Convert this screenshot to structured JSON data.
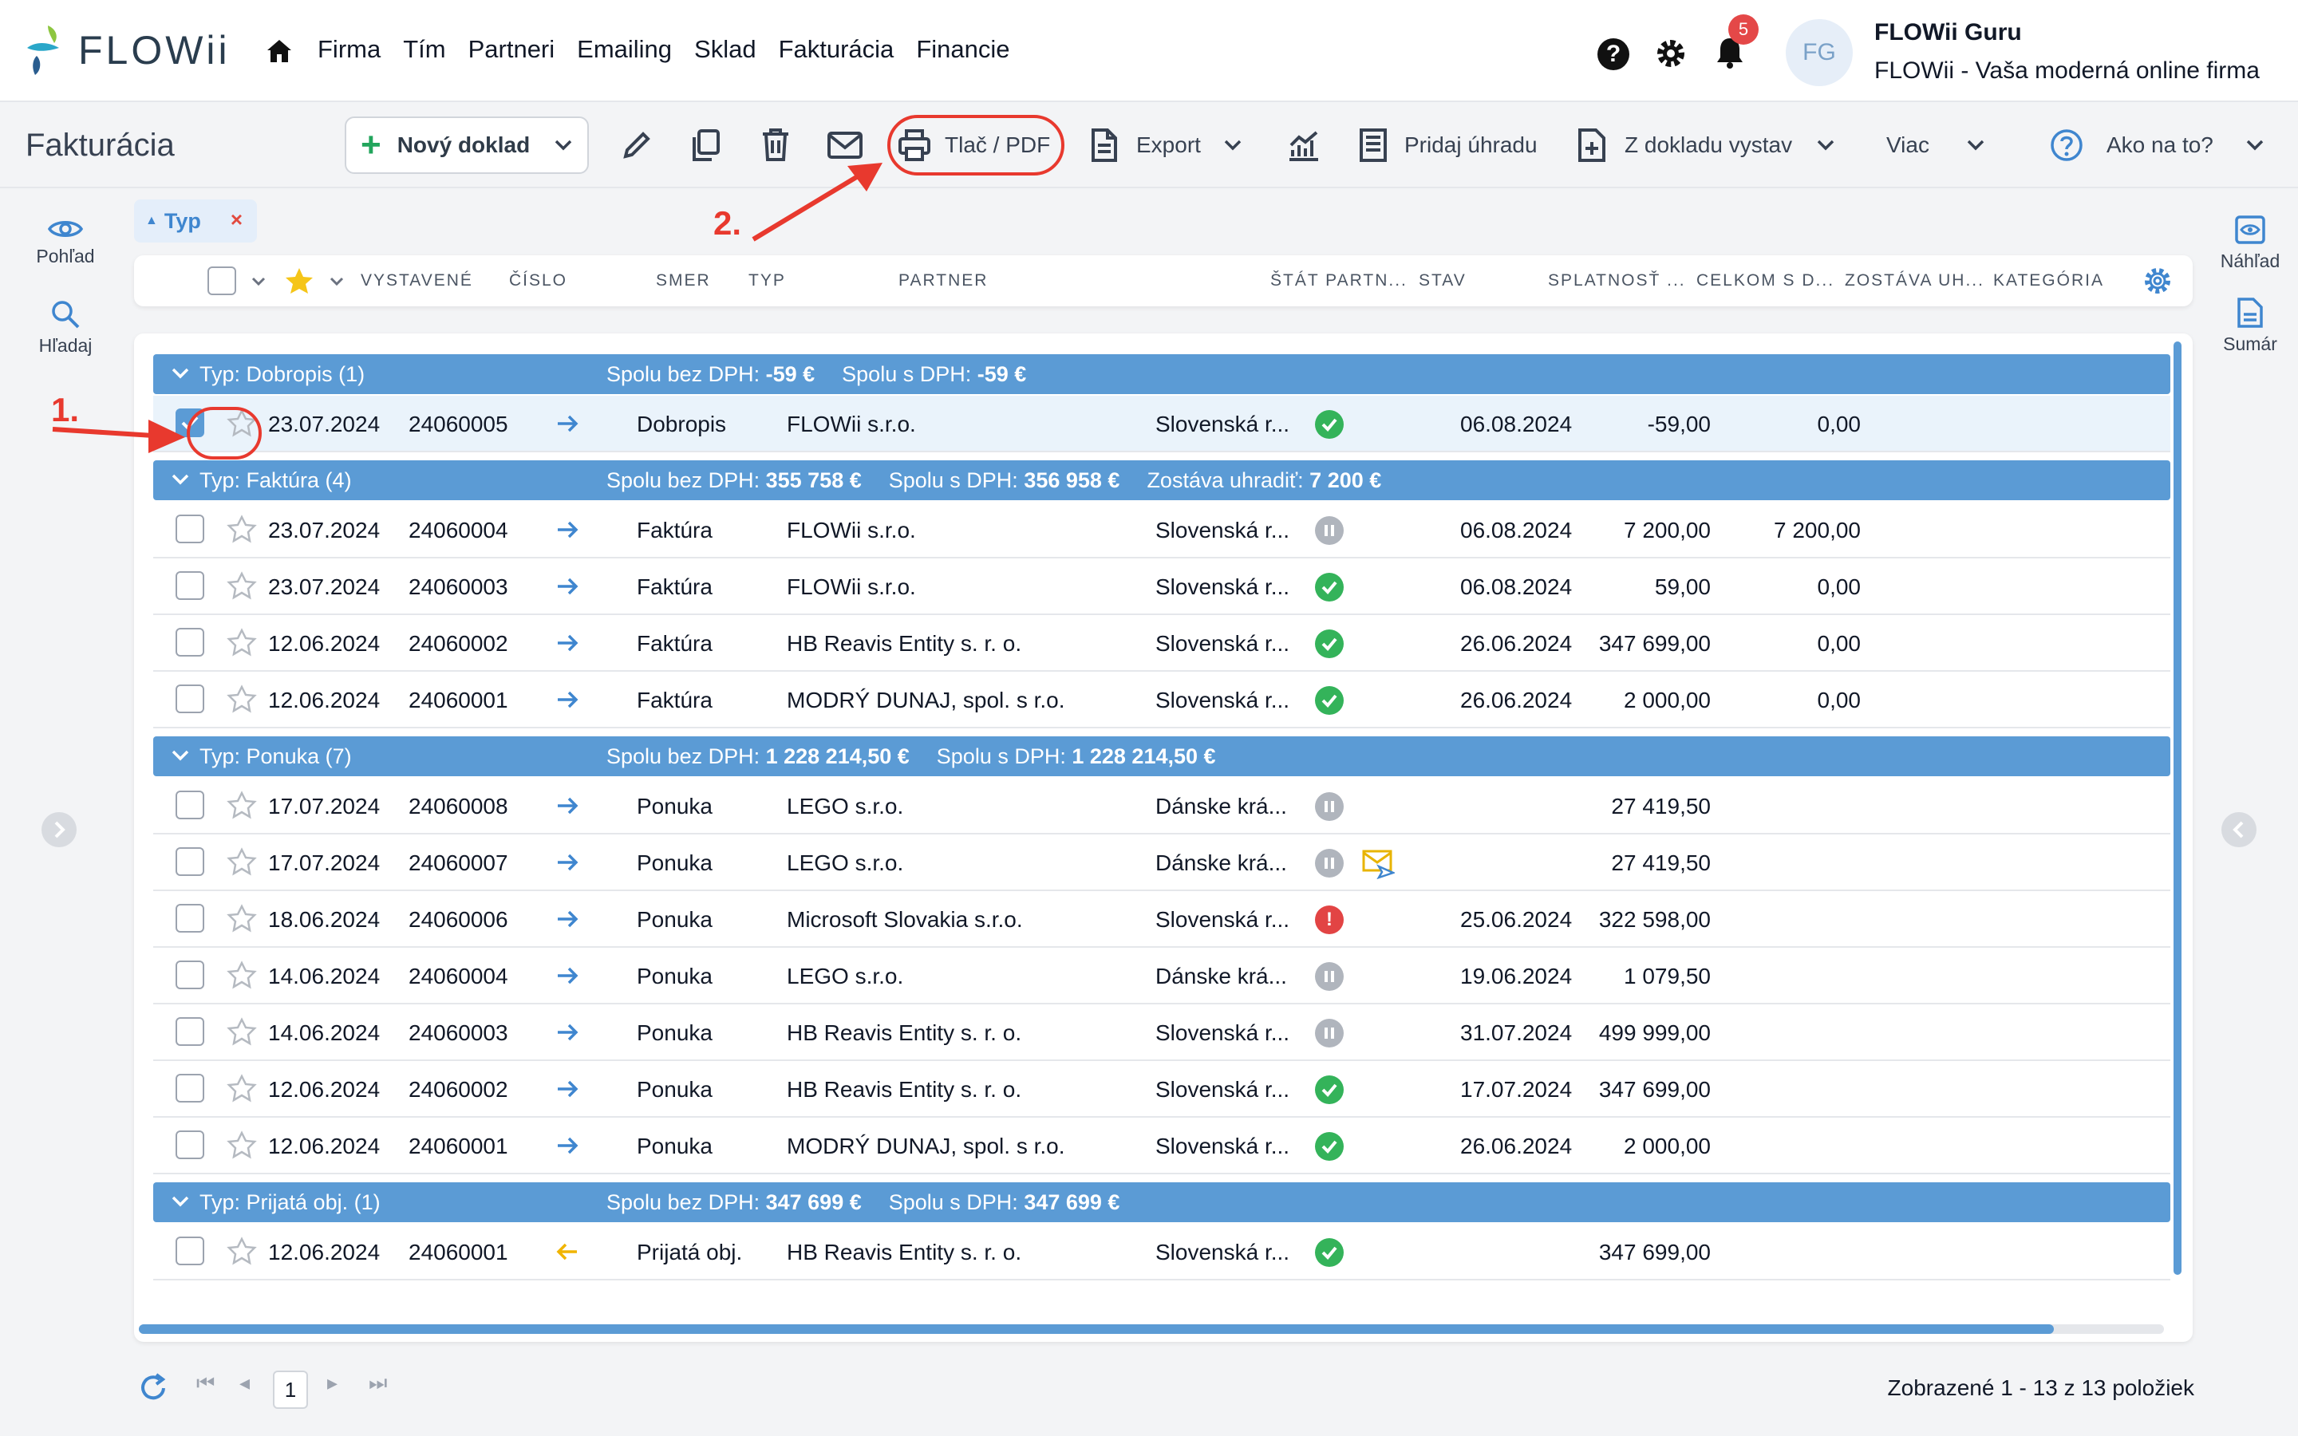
{
  "app": {
    "brand": "FLOWii",
    "nav": [
      "Firma",
      "Tím",
      "Partneri",
      "Emailing",
      "Sklad",
      "Fakturácia",
      "Financie"
    ],
    "notifications_count": "5",
    "avatar_initials": "FG",
    "user_name": "FLOWii Guru",
    "user_company": "FLOWii - Vaša moderná online firma"
  },
  "toolbar": {
    "page_title": "Fakturácia",
    "new_doc": "Nový doklad",
    "print_pdf": "Tlač / PDF",
    "export": "Export",
    "add_payment": "Pridaj úhradu",
    "issue_from_doc": "Z dokladu vystav",
    "more": "Viac",
    "how_to": "Ako na to?"
  },
  "filter_chip": {
    "label": "Typ",
    "remove": "×"
  },
  "sidebar_left": {
    "view": "Pohľad",
    "search": "Hľadaj"
  },
  "sidebar_right": {
    "preview": "Náhľad",
    "summary": "Sumár"
  },
  "columns": [
    "VYSTAVENÉ",
    "ČÍSLO",
    "SMER",
    "TYP",
    "PARTNER",
    "ŠTÁT PARTN...",
    "STAV",
    "SPLATNOSŤ ...",
    "CELKOM S D...",
    "ZOSTÁVA UH...",
    "KATEGÓRIA"
  ],
  "groups": [
    {
      "title": "Typ: Dobropis (1)",
      "sum_without_vat": "Spolu bez DPH: -59 €",
      "sum_with_vat": "Spolu s DPH: -59 €",
      "remaining": ""
    },
    {
      "title": "Typ: Faktúra (4)",
      "sum_without_vat": "Spolu bez DPH: 355 758 €",
      "sum_with_vat": "Spolu s DPH: 356 958 €",
      "remaining": "Zostáva uhradiť: 7 200 €"
    },
    {
      "title": "Typ: Ponuka (7)",
      "sum_without_vat": "Spolu bez DPH: 1 228 214,50 €",
      "sum_with_vat": "Spolu s DPH: 1 228 214,50 €",
      "remaining": ""
    },
    {
      "title": "Typ: Prijatá obj. (1)",
      "sum_without_vat": "Spolu bez DPH: 347 699 €",
      "sum_with_vat": "Spolu s DPH: 347 699 €",
      "remaining": ""
    }
  ],
  "rows": [
    {
      "date": "23.07.2024",
      "number": "24060005",
      "direction": "out",
      "type": "Dobropis",
      "partner": "FLOWii s.r.o.",
      "country": "Slovenská r...",
      "status": "ok",
      "due": "06.08.2024",
      "total": "-59,00",
      "remaining": "0,00",
      "checked": true
    },
    {
      "date": "23.07.2024",
      "number": "24060004",
      "direction": "out",
      "type": "Faktúra",
      "partner": "FLOWii s.r.o.",
      "country": "Slovenská r...",
      "status": "pending",
      "due": "06.08.2024",
      "total": "7 200,00",
      "remaining": "7 200,00"
    },
    {
      "date": "23.07.2024",
      "number": "24060003",
      "direction": "out",
      "type": "Faktúra",
      "partner": "FLOWii s.r.o.",
      "country": "Slovenská r...",
      "status": "ok",
      "due": "06.08.2024",
      "total": "59,00",
      "remaining": "0,00"
    },
    {
      "date": "12.06.2024",
      "number": "24060002",
      "direction": "out",
      "type": "Faktúra",
      "partner": "HB Reavis Entity s. r. o.",
      "country": "Slovenská r...",
      "status": "ok",
      "due": "26.06.2024",
      "total": "347 699,00",
      "remaining": "0,00"
    },
    {
      "date": "12.06.2024",
      "number": "24060001",
      "direction": "out",
      "type": "Faktúra",
      "partner": "MODRÝ DUNAJ, spol. s r.o.",
      "country": "Slovenská r...",
      "status": "ok",
      "due": "26.06.2024",
      "total": "2 000,00",
      "remaining": "0,00"
    },
    {
      "date": "17.07.2024",
      "number": "24060008",
      "direction": "out",
      "type": "Ponuka",
      "partner": "LEGO s.r.o.",
      "country": "Dánske krá...",
      "status": "pending",
      "due": "",
      "total": "27 419,50",
      "remaining": ""
    },
    {
      "date": "17.07.2024",
      "number": "24060007",
      "direction": "out",
      "type": "Ponuka",
      "partner": "LEGO s.r.o.",
      "country": "Dánske krá...",
      "status": "pending",
      "due": "",
      "total": "27 419,50",
      "remaining": "",
      "sent": true
    },
    {
      "date": "18.06.2024",
      "number": "24060006",
      "direction": "out",
      "type": "Ponuka",
      "partner": "Microsoft Slovakia s.r.o.",
      "country": "Slovenská r...",
      "status": "error",
      "due": "25.06.2024",
      "total": "322 598,00",
      "remaining": ""
    },
    {
      "date": "14.06.2024",
      "number": "24060004",
      "direction": "out",
      "type": "Ponuka",
      "partner": "LEGO s.r.o.",
      "country": "Dánske krá...",
      "status": "pending",
      "due": "19.06.2024",
      "total": "1 079,50",
      "remaining": ""
    },
    {
      "date": "14.06.2024",
      "number": "24060003",
      "direction": "out",
      "type": "Ponuka",
      "partner": "HB Reavis Entity s. r. o.",
      "country": "Slovenská r...",
      "status": "pending",
      "due": "31.07.2024",
      "total": "499 999,00",
      "remaining": ""
    },
    {
      "date": "12.06.2024",
      "number": "24060002",
      "direction": "out",
      "type": "Ponuka",
      "partner": "HB Reavis Entity s. r. o.",
      "country": "Slovenská r...",
      "status": "ok",
      "due": "17.07.2024",
      "total": "347 699,00",
      "remaining": ""
    },
    {
      "date": "12.06.2024",
      "number": "24060001",
      "direction": "out",
      "type": "Ponuka",
      "partner": "MODRÝ DUNAJ, spol. s r.o.",
      "country": "Slovenská r...",
      "status": "ok",
      "due": "26.06.2024",
      "total": "2 000,00",
      "remaining": ""
    },
    {
      "date": "12.06.2024",
      "number": "24060001",
      "direction": "in",
      "type": "Prijatá obj.",
      "partner": "HB Reavis Entity s. r. o.",
      "country": "Slovenská r...",
      "status": "ok",
      "due": "",
      "total": "347 699,00",
      "remaining": ""
    }
  ],
  "annotations": {
    "step1": "1.",
    "step2": "2."
  },
  "pagination": {
    "current_page": "1",
    "info": "Zobrazené 1 - 13 z 13 položiek"
  },
  "colors": {
    "accent": "#5b9bd5",
    "annotation": "#e8392e",
    "ok": "#34b35a",
    "pending": "#b0b5bd",
    "error": "#e24444"
  }
}
